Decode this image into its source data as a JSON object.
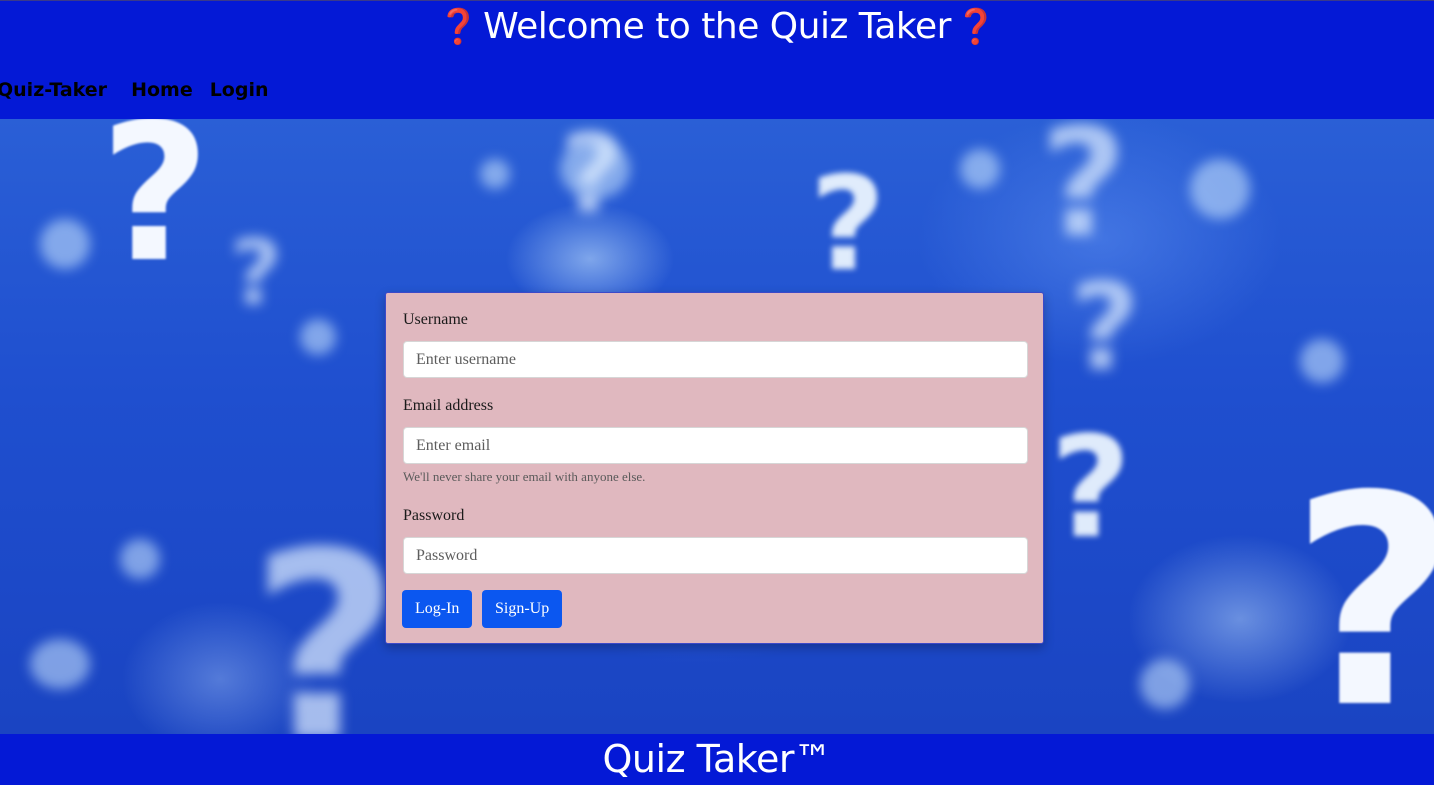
{
  "header": {
    "title": "Welcome to the Quiz Taker",
    "title_icon": "question-mark-icon",
    "title_icon_glyph": "❓",
    "title_icon_color": "#d1001f",
    "background": "#0419d6"
  },
  "nav": {
    "brand": "Quiz-Taker",
    "links": [
      "Home",
      "Login"
    ]
  },
  "hero": {
    "background_theme": "blue-bokeh-question-marks",
    "glyph": "?"
  },
  "login_form": {
    "username": {
      "label": "Username",
      "placeholder": "Enter username",
      "value": ""
    },
    "email": {
      "label": "Email address",
      "placeholder": "Enter email",
      "value": "",
      "help": "We'll never share your email with anyone else."
    },
    "password": {
      "label": "Password",
      "placeholder": "Password",
      "value": ""
    },
    "buttons": {
      "login": "Log-In",
      "signup": "Sign-Up"
    },
    "card_color": "#e0b8bf",
    "button_color": "#0b57f0"
  },
  "footer": {
    "title": "Quiz Taker™"
  }
}
